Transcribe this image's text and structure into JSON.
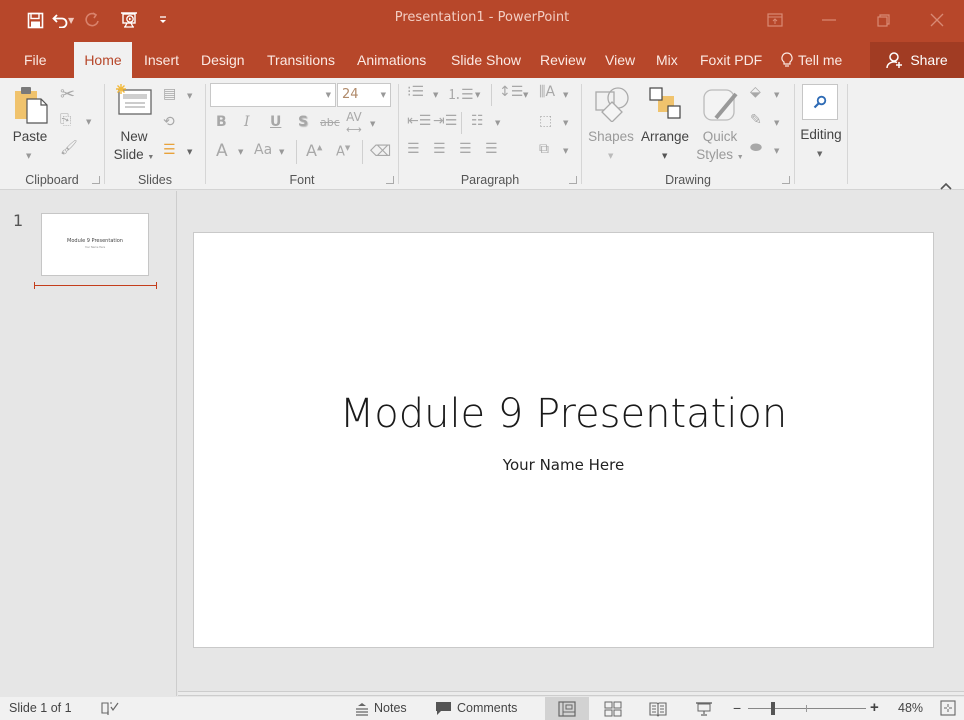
{
  "app": {
    "document_name": "Presentation1",
    "separator": " - ",
    "app_name": "PowerPoint",
    "accent_color": "#b7472a"
  },
  "quick_access": [
    {
      "name": "save-icon",
      "glyph": "🖫"
    },
    {
      "name": "undo-icon",
      "glyph": "↶"
    },
    {
      "name": "redo-icon",
      "glyph": "↻"
    },
    {
      "name": "start-from-beginning-icon",
      "glyph": "⎚"
    },
    {
      "name": "customize-qat-icon",
      "glyph": "≑"
    }
  ],
  "window_controls": {
    "ribbon_display": "⊡",
    "minimize": "—",
    "restore": "❐",
    "close": "✕"
  },
  "tabs": [
    {
      "label": "File"
    },
    {
      "label": "Home",
      "active": true
    },
    {
      "label": "Insert"
    },
    {
      "label": "Design"
    },
    {
      "label": "Transitions"
    },
    {
      "label": "Animations"
    },
    {
      "label": "Slide Show"
    },
    {
      "label": "Review"
    },
    {
      "label": "View"
    },
    {
      "label": "Mix"
    },
    {
      "label": "Foxit PDF"
    }
  ],
  "tell_me": {
    "label": "Tell me",
    "icon": "💡"
  },
  "share": {
    "label": "Share"
  },
  "ribbon": {
    "clipboard": {
      "label": "Clipboard",
      "paste": "Paste"
    },
    "slides": {
      "label": "Slides",
      "new_slide_line1": "New",
      "new_slide_line2": "Slide"
    },
    "font": {
      "label": "Font",
      "font_name": "",
      "font_size": "24",
      "buttons": [
        "B",
        "I",
        "U",
        "S",
        "abc",
        "AV"
      ]
    },
    "paragraph": {
      "label": "Paragraph"
    },
    "drawing": {
      "label": "Drawing",
      "shapes": "Shapes",
      "arrange": "Arrange",
      "quick_line1": "Quick",
      "quick_line2": "Styles"
    },
    "editing": {
      "label": "Editing"
    }
  },
  "slides_pane": {
    "slides": [
      {
        "number": "1",
        "title": "Module 9 Presentation",
        "subtitle": "Your Name Here"
      }
    ]
  },
  "slide": {
    "title": "Module 9 Presentation",
    "subtitle": "Your Name Here"
  },
  "status": {
    "slide_indicator": "Slide 1 of 1",
    "notes": "Notes",
    "comments": "Comments",
    "zoom_percent": "48%",
    "zoom_level": 0.48
  }
}
